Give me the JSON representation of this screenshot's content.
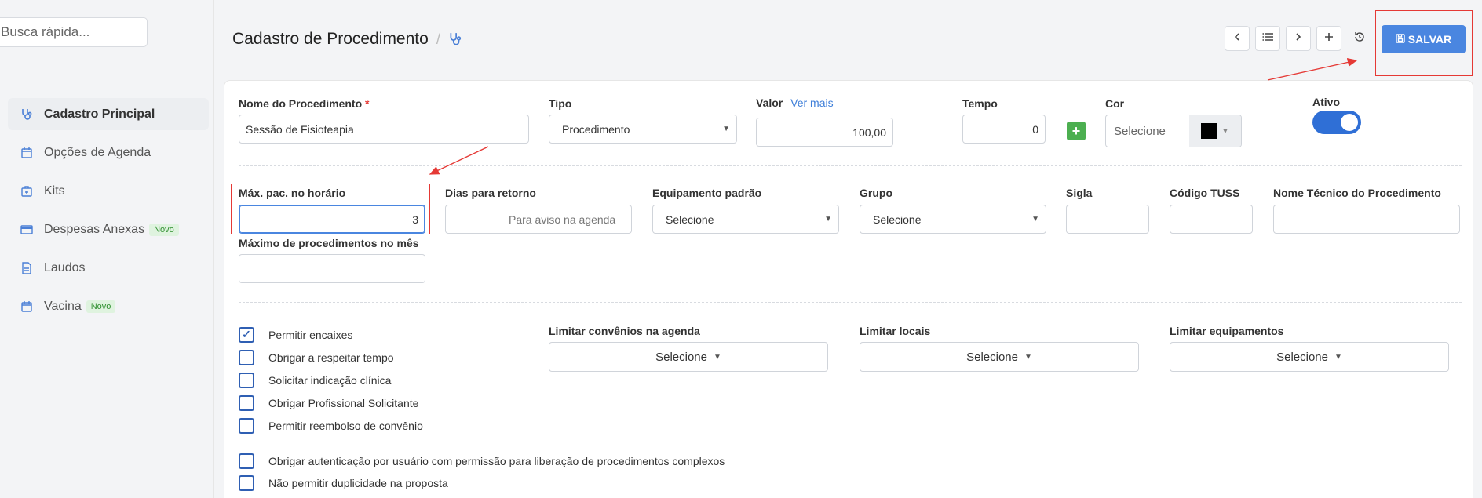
{
  "sidebar": {
    "search_placeholder": "Busca rápida...",
    "items": [
      {
        "label": "Cadastro Principal",
        "icon": "stethoscope-icon",
        "badge": ""
      },
      {
        "label": "Opções de Agenda",
        "icon": "calendar-icon",
        "badge": ""
      },
      {
        "label": "Kits",
        "icon": "kit-plus-icon",
        "badge": ""
      },
      {
        "label": "Despesas Anexas",
        "icon": "credit-card-icon",
        "badge": "Novo"
      },
      {
        "label": "Laudos",
        "icon": "document-icon",
        "badge": ""
      },
      {
        "label": "Vacina",
        "icon": "calendar-icon",
        "badge": "Novo"
      }
    ]
  },
  "header": {
    "title": "Cadastro de Procedimento",
    "separator": "/",
    "save_label": "SALVAR"
  },
  "form": {
    "nome": {
      "label": "Nome do Procedimento",
      "required": "*",
      "value": "Sessão de Fisioteapia"
    },
    "tipo": {
      "label": "Tipo",
      "value": "Procedimento"
    },
    "valor": {
      "label": "Valor",
      "link": "Ver mais",
      "value": "100,00"
    },
    "tempo": {
      "label": "Tempo",
      "value": "0"
    },
    "cor": {
      "label": "Cor",
      "placeholder": "Selecione",
      "swatch_color": "#000000"
    },
    "ativo": {
      "label": "Ativo",
      "on": true
    },
    "max_pac": {
      "label": "Máx. pac. no horário",
      "value": "3"
    },
    "dias_retorno": {
      "label": "Dias para retorno",
      "placeholder": "Para aviso na agenda"
    },
    "equipamento": {
      "label": "Equipamento padrão",
      "value": "Selecione"
    },
    "grupo": {
      "label": "Grupo",
      "value": "Selecione"
    },
    "sigla": {
      "label": "Sigla",
      "value": ""
    },
    "tuss": {
      "label": "Código TUSS",
      "value": ""
    },
    "nome_tecnico": {
      "label": "Nome Técnico do Procedimento",
      "value": ""
    },
    "max_mes": {
      "label": "Máximo de procedimentos no mês",
      "value": ""
    },
    "checkboxes": [
      {
        "label": "Permitir encaixes",
        "checked": true
      },
      {
        "label": "Obrigar a respeitar tempo",
        "checked": false
      },
      {
        "label": "Solicitar indicação clínica",
        "checked": false
      },
      {
        "label": "Obrigar Profissional Solicitante",
        "checked": false
      },
      {
        "label": "Permitir reembolso de convênio",
        "checked": false
      }
    ],
    "checkboxes2": [
      {
        "label": "Obrigar autenticação por usuário com permissão para liberação de procedimentos complexos",
        "checked": false
      },
      {
        "label": "Não permitir duplicidade na proposta",
        "checked": false
      }
    ],
    "limitar_convenios": {
      "label": "Limitar convênios na agenda",
      "value": "Selecione"
    },
    "limitar_locais": {
      "label": "Limitar locais",
      "value": "Selecione"
    },
    "limitar_equipamentos": {
      "label": "Limitar equipamentos",
      "value": "Selecione"
    }
  },
  "colors": {
    "accent": "#4a86e0",
    "annotation": "#e53935",
    "success": "#4caf50"
  }
}
